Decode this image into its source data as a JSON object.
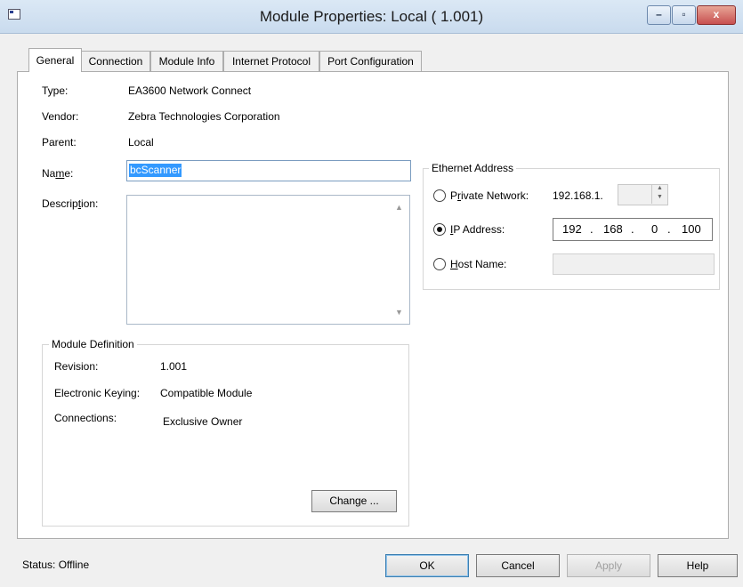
{
  "window": {
    "title": "Module Properties: Local ( 1.001)",
    "minimize_glyph": "–",
    "maximize_glyph": "▫",
    "close_glyph": "x"
  },
  "tabs": [
    {
      "label": "General"
    },
    {
      "label": "Connection"
    },
    {
      "label": "Module Info"
    },
    {
      "label": "Internet Protocol"
    },
    {
      "label": "Port Configuration"
    }
  ],
  "general": {
    "type_label": "Type:",
    "type_value": "EA3600 Network Connect",
    "vendor_label": "Vendor:",
    "vendor_value": "Zebra Technologies Corporation",
    "parent_label": "Parent:",
    "parent_value": "Local",
    "name_label_pre": "Na",
    "name_label_u": "m",
    "name_label_post": "e:",
    "name_value": "bcScanner",
    "description_label_pre": "Descrip",
    "description_label_u": "t",
    "description_label_post": "ion:",
    "description_value": ""
  },
  "ethernet": {
    "group_title": "Ethernet Address",
    "private_label_pre": "P",
    "private_label_u": "r",
    "private_label_post": "ivate Network:",
    "private_prefix": "192.168.1.",
    "private_value": "",
    "ip_label_pre": "",
    "ip_label_u": "I",
    "ip_label_post": "P Address:",
    "ip_octets": [
      "192",
      "168",
      "0",
      "100"
    ],
    "ip_dot": ".",
    "host_label_pre": "",
    "host_label_u": "H",
    "host_label_post": "ost Name:",
    "host_value": "",
    "selected": "ip"
  },
  "module_definition": {
    "group_title": "Module Definition",
    "revision_label": "Revision:",
    "revision_value": "1.001",
    "keying_label": "Electronic Keying:",
    "keying_value": "Compatible Module",
    "connections_label": "Connections:",
    "connections_value": "Exclusive Owner",
    "change_button": "Change ..."
  },
  "footer": {
    "status": "Status:  Offline",
    "ok": "OK",
    "cancel": "Cancel",
    "apply": "Apply",
    "help": "Help"
  },
  "colors": {
    "selection": "#3399ff",
    "textbox_border": "#7a9cc0",
    "titlebar": "#c9dbee",
    "close_button": "#c75050"
  }
}
